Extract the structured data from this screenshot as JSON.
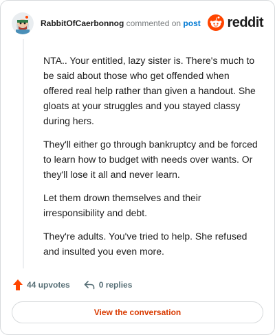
{
  "header": {
    "username": "RabbitOfCaerbonnog",
    "action_text": "commented on",
    "post_link": "post",
    "brand_name": "reddit"
  },
  "comment": {
    "paragraphs": [
      "NTA.. Your entitled, lazy sister is. There's much to be said about those who get offended when offered real help rather than given a handout. She gloats at your struggles and you stayed classy during hers.",
      "They'll either go through bankruptcy and be forced to learn how to budget with needs over wants. Or they'll lose it all and never learn.",
      "Let them drown themselves and their irresponsibility and debt.",
      "They're adults. You've tried to help. She refused and insulted you even more."
    ]
  },
  "footer": {
    "upvotes": "44 upvotes",
    "replies": "0 replies",
    "upvote_icon": "upvote-arrow-icon",
    "reply_icon": "reply-arrow-icon"
  },
  "cta": {
    "label": "View the conversation"
  },
  "colors": {
    "brand": "#ff4500",
    "link": "#0079d3",
    "cta_text": "#d93a00",
    "muted": "#787c7e",
    "border": "#d7dadc"
  }
}
